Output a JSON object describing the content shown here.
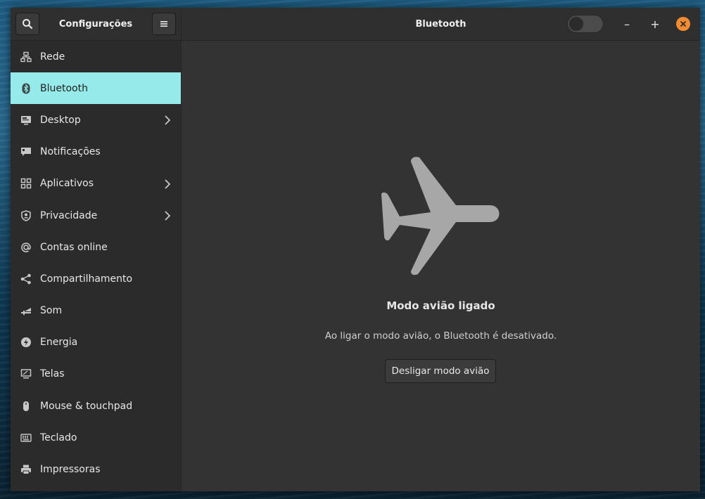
{
  "app": {
    "title": "Configurações"
  },
  "page": {
    "title": "Bluetooth"
  },
  "header": {
    "search_icon": "search-icon",
    "menu_icon": "hamburger-menu-icon",
    "bluetooth_toggle_on": false,
    "minimize_label": "–",
    "maximize_label": "+",
    "close_icon": "close-icon"
  },
  "sidebar": {
    "items": [
      {
        "label": "Rede",
        "icon": "network-icon",
        "chevron": false,
        "active": false
      },
      {
        "label": "Bluetooth",
        "icon": "bluetooth-icon",
        "chevron": false,
        "active": true
      },
      {
        "label": "Desktop",
        "icon": "desktop-icon",
        "chevron": true,
        "active": false
      },
      {
        "label": "Notificações",
        "icon": "notifications-icon",
        "chevron": false,
        "active": false
      },
      {
        "label": "Aplicativos",
        "icon": "apps-grid-icon",
        "chevron": true,
        "active": false
      },
      {
        "label": "Privacidade",
        "icon": "privacy-icon",
        "chevron": true,
        "active": false
      },
      {
        "label": "Contas online",
        "icon": "at-sign-icon",
        "chevron": false,
        "active": false
      },
      {
        "label": "Compartilhamento",
        "icon": "share-icon",
        "chevron": false,
        "active": false
      },
      {
        "label": "Som",
        "icon": "sound-icon",
        "chevron": false,
        "active": false
      },
      {
        "label": "Energia",
        "icon": "power-icon",
        "chevron": false,
        "active": false
      },
      {
        "label": "Telas",
        "icon": "display-icon",
        "chevron": false,
        "active": false
      },
      {
        "label": "Mouse & touchpad",
        "icon": "mouse-icon",
        "chevron": false,
        "active": false
      },
      {
        "label": "Teclado",
        "icon": "keyboard-icon",
        "chevron": false,
        "active": false
      },
      {
        "label": "Impressoras",
        "icon": "printer-icon",
        "chevron": false,
        "active": false
      }
    ]
  },
  "main": {
    "illustration": "airplane-icon",
    "title": "Modo avião ligado",
    "description": "Ao ligar o modo avião, o Bluetooth é desativado.",
    "action_label": "Desligar modo avião"
  },
  "colors": {
    "accent": "#96ebea",
    "close": "#f28c32",
    "background": "#333333",
    "sidebar": "#2b2b2b"
  }
}
